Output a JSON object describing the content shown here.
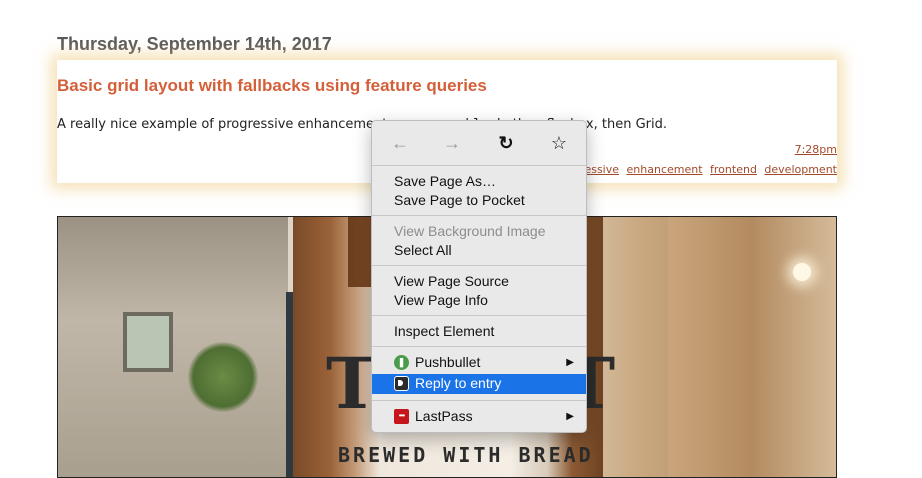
{
  "entry": {
    "date": "Thursday, September 14th, 2017",
    "title": "Basic grid layout with fallbacks using feature queries",
    "text_before": "A really nice example of progressive enhancement",
    "text_code": "block",
    "text_after": ", then flexbox, then Grid.",
    "time": "7:28pm",
    "tags": [
      "d",
      "progressive",
      "enhancement",
      "frontend",
      "development"
    ]
  },
  "photo": {
    "brewed_text": "BREWED WITH BREAD",
    "big_letter_left": "T",
    "big_letter_right": "T"
  },
  "context_menu": {
    "nav": {
      "back_icon": "←",
      "forward_icon": "→",
      "reload_icon": "↻",
      "bookmark_icon": "☆"
    },
    "items": {
      "save_page_as": "Save Page As…",
      "save_to_pocket": "Save Page to Pocket",
      "view_background_image": "View Background Image",
      "select_all": "Select All",
      "view_page_source": "View Page Source",
      "view_page_info": "View Page Info",
      "inspect_element": "Inspect Element",
      "pushbullet": "Pushbullet",
      "reply_to_entry": "Reply to entry",
      "lastpass": "LastPass"
    },
    "icons": {
      "pushbullet": "pushbullet-icon",
      "reply": "reply-icon",
      "lastpass": "lastpass-icon",
      "lastpass_glyph": "•••"
    },
    "submenu_arrow": "▶",
    "highlight_color": "#1b73e8"
  }
}
